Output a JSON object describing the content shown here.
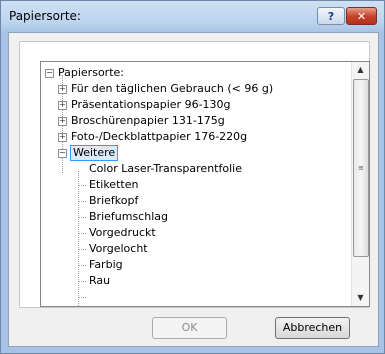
{
  "window": {
    "title": "Papiersorte:",
    "help_label": "?",
    "close_label": "✕"
  },
  "tree": {
    "root": {
      "label": "Papiersorte:",
      "expander": "−"
    },
    "groups": [
      {
        "label": "Für den täglichen Gebrauch (< 96 g)",
        "expander": "+"
      },
      {
        "label": "Präsentationspapier 96-130g",
        "expander": "+"
      },
      {
        "label": "Broschürenpapier 131-175g",
        "expander": "+"
      },
      {
        "label": "Foto-/Deckblattpapier 176-220g",
        "expander": "+"
      },
      {
        "label": "Weitere",
        "expander": "−",
        "selected": true
      }
    ],
    "children": [
      "Color Laser-Transparentfolie",
      "Etiketten",
      "Briefkopf",
      "Briefumschlag",
      "Vorgedruckt",
      "Vorgelocht",
      "Farbig",
      "Rau"
    ]
  },
  "scrollbar": {
    "up_icon": "▲",
    "down_icon": "▼",
    "grip": "≡"
  },
  "buttons": {
    "ok_label": "OK",
    "cancel_label": "Abbrechen"
  }
}
